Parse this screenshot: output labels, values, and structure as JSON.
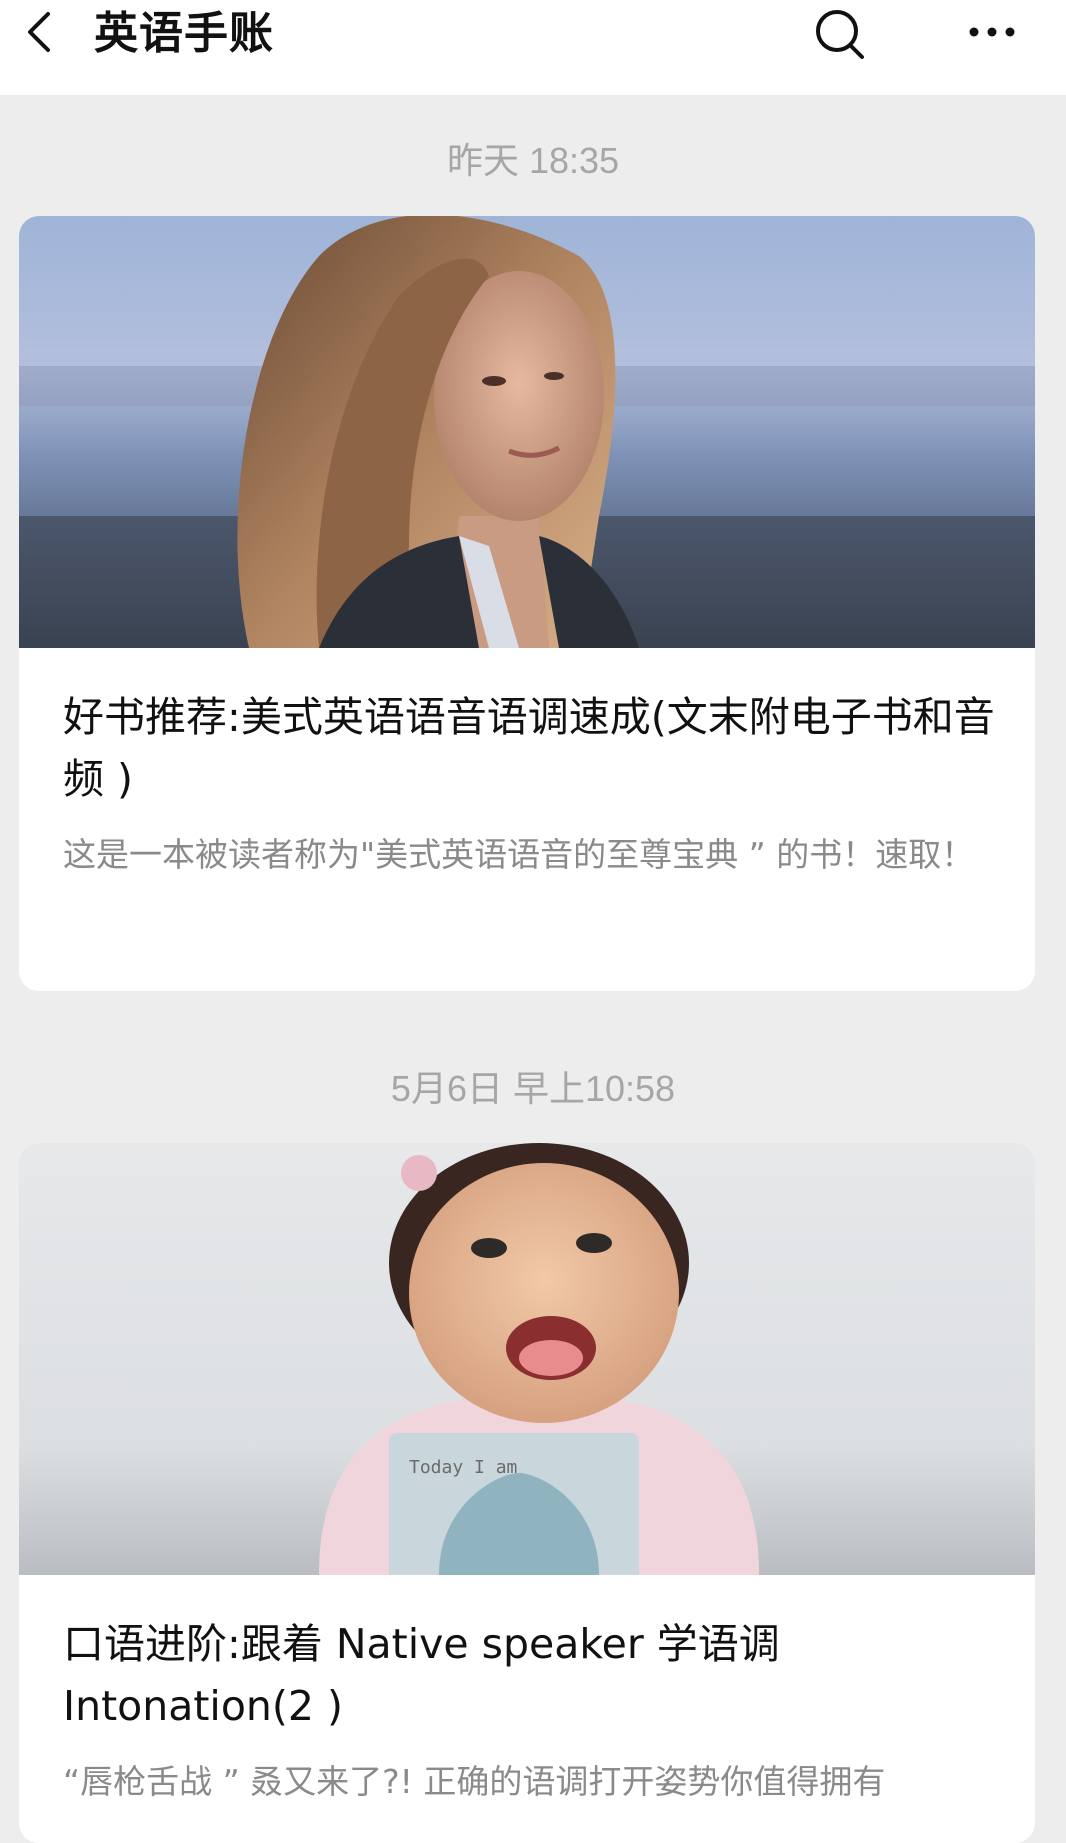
{
  "header": {
    "title": "英语手账",
    "back_icon": "chevron-left-icon",
    "search_icon": "search-icon",
    "more_icon": "more-horizontal-icon"
  },
  "articles": [
    {
      "timestamp": "昨天 18:35",
      "cover_description_icon": "photo-woman-portrait",
      "title": "好书推荐:美式英语语音语调速成(文末附电子书和音频 )",
      "summary": "这是一本被读者称为\"美式英语语音的至尊宝典 ” 的书！速取！"
    },
    {
      "timestamp": "5月6日 早上10:58",
      "cover_description_icon": "photo-baby-card",
      "cover_card_text": "Today I am",
      "title": "口语进阶:跟着 Native speaker 学语调 Intonation(2 )",
      "summary": "“唇枪舌战 ” 叒又来了?!  正确的语调打开姿势你值得拥有"
    }
  ],
  "colors": {
    "background": "#ededed",
    "card": "#ffffff",
    "timestamp_text": "#a6a6a6",
    "summary_text": "#8a8a8a"
  }
}
